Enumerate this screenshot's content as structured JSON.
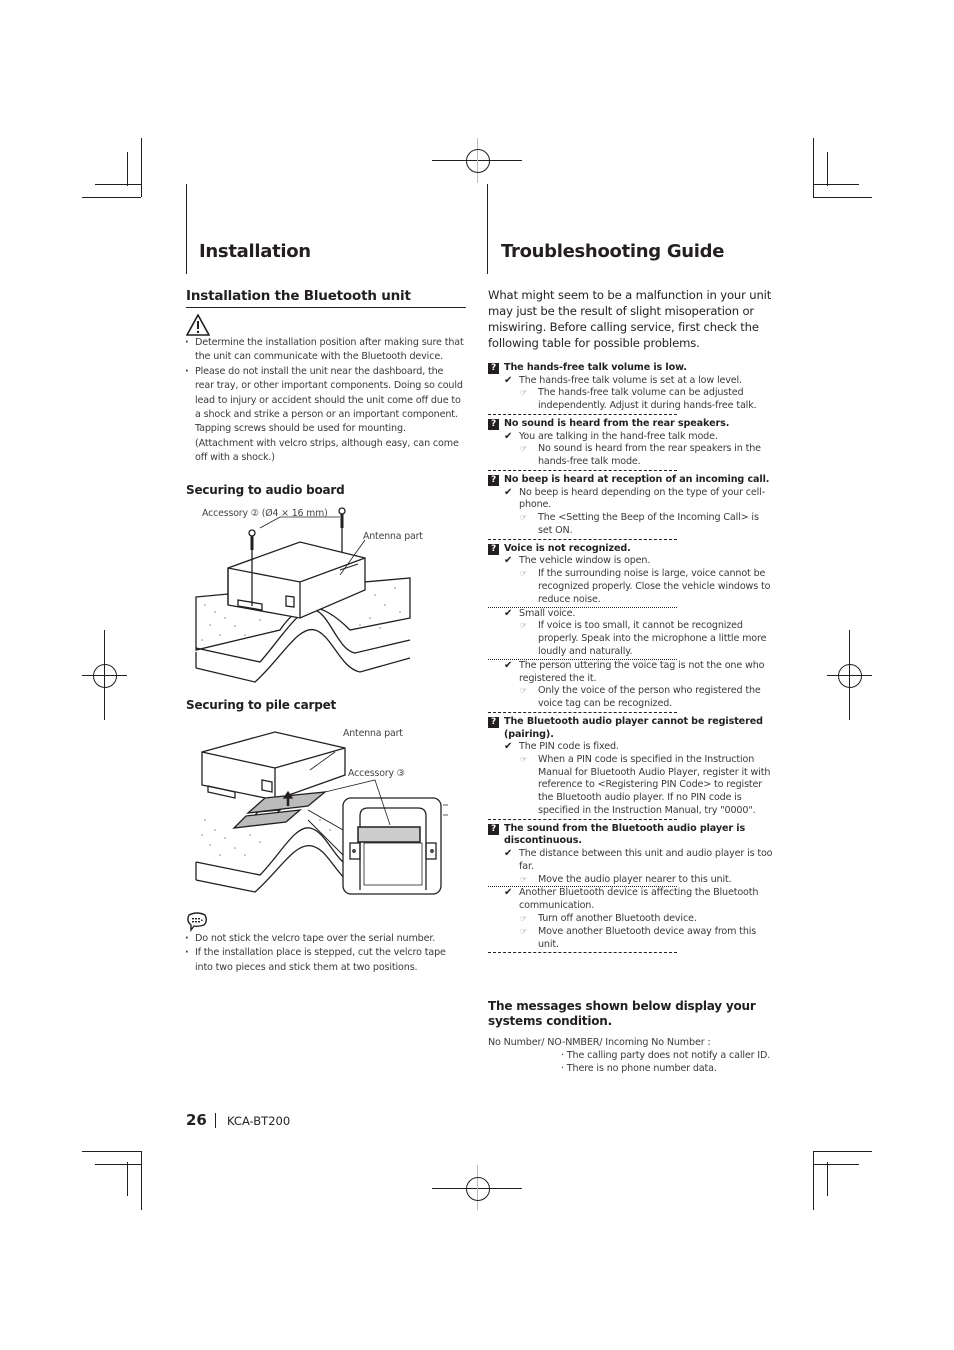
{
  "left": {
    "section_title": "Installation",
    "subsection_title": "Installation the Bluetooth unit",
    "warning_icon": "warning-triangle-icon",
    "warnings": [
      "Determine the installation position after making sure that the unit can communicate with the Bluetooth device.",
      "Please do not install the unit near the dashboard, the rear tray, or other important components. Doing so could lead to injury or accident should the unit come off due to a shock and strike a person or an important component. Tapping screws should be used for mounting. (Attachment with velcro strips, although easy, can come off with a shock.)"
    ],
    "audio_board": {
      "heading": "Securing to audio board",
      "label_accessory": "Accessory ② (Ø4 × 16 mm)",
      "label_antenna": "Antenna part"
    },
    "pile_carpet": {
      "heading": "Securing to pile carpet",
      "label_antenna": "Antenna part",
      "label_accessory": "Accessory ③"
    },
    "note_icon": "note-speech-bubble-icon",
    "notes": [
      "Do not stick the velcro tape over the serial number.",
      "If the installation place is stepped, cut the velcro tape into two pieces and stick them at two positions."
    ]
  },
  "right": {
    "section_title": "Troubleshooting Guide",
    "intro": "What might seem to be a malfunction in your unit may just be the result of slight misoperation or miswiring. Before calling service, first check the following table for possible problems.",
    "problems": [
      {
        "title": "The hands-free talk volume is low.",
        "causes": [
          {
            "cause": "The hands-free talk volume is set at a low level.",
            "remedies": [
              "The hands-free talk volume can be adjusted independently. Adjust it during hands-free talk."
            ]
          }
        ]
      },
      {
        "title": "No sound is heard from the rear speakers.",
        "causes": [
          {
            "cause": "You are talking in the hand-free talk mode.",
            "remedies": [
              "No sound is heard from the rear speakers in the hands-free talk mode."
            ]
          }
        ]
      },
      {
        "title": "No beep is heard at reception of an incoming call.",
        "causes": [
          {
            "cause": "No beep is heard depending on the type of your cell-phone.",
            "remedies": [
              "The <Setting the Beep of the Incoming Call> is set ON."
            ]
          }
        ]
      },
      {
        "title": "Voice is not recognized.",
        "causes": [
          {
            "cause": "The vehicle window is open.",
            "remedies": [
              "If the surrounding noise is large, voice cannot be recognized properly. Close the vehicle windows to reduce noise."
            ]
          },
          {
            "cause": "Small voice.",
            "remedies": [
              "If voice is too small, it cannot be recognized properly. Speak into the microphone a little more loudly and naturally."
            ]
          },
          {
            "cause": "The person uttering the voice tag is not the one who registered the it.",
            "remedies": [
              "Only the voice of the person who registered the voice tag can be recognized."
            ]
          }
        ]
      },
      {
        "title": "The Bluetooth audio player cannot be registered (pairing).",
        "causes": [
          {
            "cause": "The PIN code is fixed.",
            "remedies": [
              "When a PIN code is specified in the Instruction Manual for Bluetooth Audio Player, register it with reference to <Registering PIN Code> to register the Bluetooth audio player. If no PIN code is specified in the Instruction Manual, try \"0000\"."
            ]
          }
        ]
      },
      {
        "title": "The sound from the Bluetooth audio player is discontinuous.",
        "causes": [
          {
            "cause": "The distance between this unit and audio player is too far.",
            "remedies": [
              "Move the audio player nearer to this unit."
            ]
          },
          {
            "cause": "Another Bluetooth device is affecting the Bluetooth communication.",
            "remedies": [
              "Turn off another Bluetooth device.",
              "Move another Bluetooth device away from this unit."
            ]
          }
        ]
      }
    ],
    "messages_heading": "The messages shown below display your systems condition.",
    "messages": [
      {
        "label": "No Number/ NO-NMBER/ Incoming No Number :",
        "meanings": [
          "The calling party does not notify a caller ID.",
          "There is no phone number data."
        ]
      }
    ]
  },
  "footer": {
    "page_number": "26",
    "model": "KCA-BT200"
  }
}
